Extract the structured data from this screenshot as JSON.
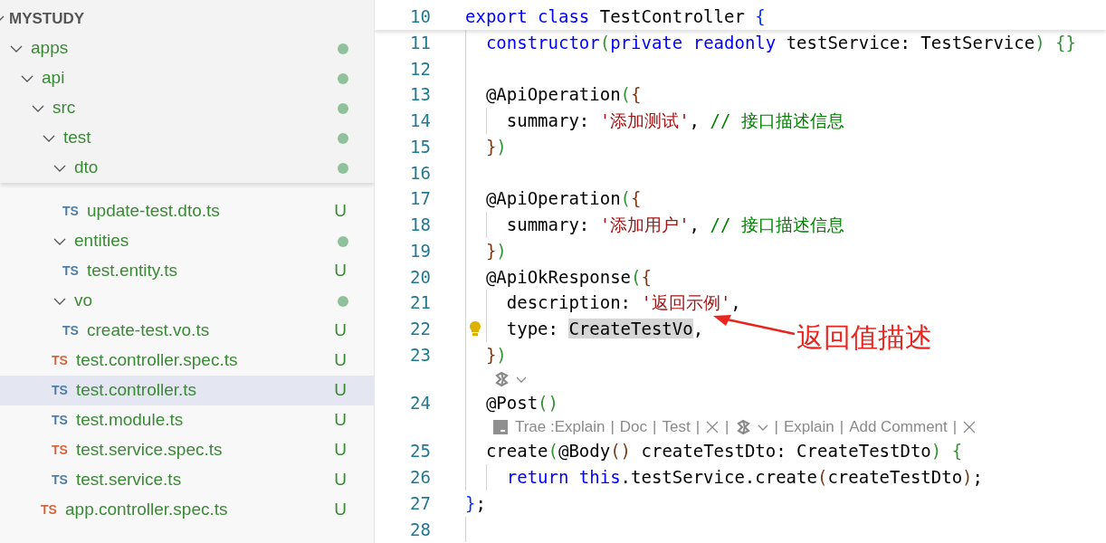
{
  "explorer": {
    "root": {
      "label": "MYSTUDY",
      "expanded": true
    },
    "tree": [
      {
        "kind": "folder",
        "label": "apps",
        "expanded": true,
        "modified": true,
        "children": [
          {
            "kind": "folder",
            "label": "api",
            "expanded": true,
            "modified": true,
            "children": [
              {
                "kind": "folder",
                "label": "src",
                "expanded": true,
                "modified": true,
                "children": [
                  {
                    "kind": "folder",
                    "label": "test",
                    "expanded": true,
                    "modified": true,
                    "children": [
                      {
                        "kind": "folder",
                        "label": "dto",
                        "expanded": true,
                        "modified": true,
                        "children": [
                          {
                            "kind": "file",
                            "label": "update-test.dto.ts",
                            "icon": "TS",
                            "color": "#4d7ea8",
                            "status": "U",
                            "selected": false
                          }
                        ]
                      },
                      {
                        "kind": "folder",
                        "label": "entities",
                        "expanded": true,
                        "modified": true,
                        "children": [
                          {
                            "kind": "file",
                            "label": "test.entity.ts",
                            "icon": "TS",
                            "color": "#4d7ea8",
                            "status": "U",
                            "selected": false
                          }
                        ]
                      },
                      {
                        "kind": "folder",
                        "label": "vo",
                        "expanded": true,
                        "modified": true,
                        "children": [
                          {
                            "kind": "file",
                            "label": "create-test.vo.ts",
                            "icon": "TS",
                            "color": "#4d7ea8",
                            "status": "U",
                            "selected": false
                          }
                        ]
                      },
                      {
                        "kind": "file",
                        "label": "test.controller.spec.ts",
                        "icon": "TS",
                        "color": "#d5673a",
                        "status": "U",
                        "selected": false
                      },
                      {
                        "kind": "file",
                        "label": "test.controller.ts",
                        "icon": "TS",
                        "color": "#4d7ea8",
                        "status": "U",
                        "selected": true
                      },
                      {
                        "kind": "file",
                        "label": "test.module.ts",
                        "icon": "TS",
                        "color": "#4d7ea8",
                        "status": "U",
                        "selected": false
                      },
                      {
                        "kind": "file",
                        "label": "test.service.spec.ts",
                        "icon": "TS",
                        "color": "#d5673a",
                        "status": "U",
                        "selected": false
                      },
                      {
                        "kind": "file",
                        "label": "test.service.ts",
                        "icon": "TS",
                        "color": "#4d7ea8",
                        "status": "U",
                        "selected": false
                      }
                    ]
                  },
                  {
                    "kind": "file",
                    "label": "app.controller.spec.ts",
                    "icon": "TS",
                    "color": "#d5673a",
                    "status": "U",
                    "selected": false
                  }
                ]
              }
            ]
          }
        ]
      }
    ]
  },
  "editor": {
    "sticky_lines": [
      {
        "kind": "code",
        "number": "10",
        "tokens": [
          {
            "kind": "keyword",
            "text": "export "
          },
          {
            "kind": "keyword",
            "text": "class "
          },
          {
            "kind": "plain",
            "text": "TestController "
          },
          {
            "kind": "bracket1",
            "text": "{"
          }
        ]
      }
    ],
    "lines": [
      {
        "kind": "code",
        "number": "11",
        "tokens": [
          {
            "kind": "keyword",
            "text": "  constructor"
          },
          {
            "kind": "bracket2",
            "text": "("
          },
          {
            "kind": "keyword",
            "text": "private "
          },
          {
            "kind": "keyword",
            "text": "readonly "
          },
          {
            "kind": "plain",
            "text": "testService: TestService"
          },
          {
            "kind": "bracket2",
            "text": ") {}"
          }
        ]
      },
      {
        "kind": "code",
        "number": "12"
      },
      {
        "kind": "code",
        "number": "13",
        "tokens": [
          {
            "kind": "plain",
            "text": "  @ApiOperation"
          },
          {
            "kind": "bracket2",
            "text": "("
          },
          {
            "kind": "bracket3",
            "text": "{"
          }
        ]
      },
      {
        "kind": "code",
        "number": "14",
        "tokens": [
          {
            "kind": "plain",
            "text": "    summary: "
          },
          {
            "kind": "string",
            "text": "'添加测试'"
          },
          {
            "kind": "plain",
            "text": ", "
          },
          {
            "kind": "comment",
            "text": "// 接口描述信息"
          }
        ]
      },
      {
        "kind": "code",
        "number": "15",
        "tokens": [
          {
            "kind": "bracket3",
            "text": "  }"
          },
          {
            "kind": "bracket2",
            "text": ")"
          }
        ]
      },
      {
        "kind": "code",
        "number": "16"
      },
      {
        "kind": "code",
        "number": "17",
        "tokens": [
          {
            "kind": "plain",
            "text": "  @ApiOperation"
          },
          {
            "kind": "bracket2",
            "text": "("
          },
          {
            "kind": "bracket3",
            "text": "{"
          }
        ]
      },
      {
        "kind": "code",
        "number": "18",
        "tokens": [
          {
            "kind": "plain",
            "text": "    summary: "
          },
          {
            "kind": "string",
            "text": "'添加用户'"
          },
          {
            "kind": "plain",
            "text": ", "
          },
          {
            "kind": "comment",
            "text": "// 接口描述信息"
          }
        ]
      },
      {
        "kind": "code",
        "number": "19",
        "tokens": [
          {
            "kind": "bracket3",
            "text": "  }"
          },
          {
            "kind": "bracket2",
            "text": ")"
          }
        ]
      },
      {
        "kind": "code",
        "number": "20",
        "tokens": [
          {
            "kind": "plain",
            "text": "  @ApiOkResponse"
          },
          {
            "kind": "bracket2",
            "text": "("
          },
          {
            "kind": "bracket3",
            "text": "{"
          }
        ]
      },
      {
        "kind": "code",
        "number": "21",
        "tokens": [
          {
            "kind": "plain",
            "text": "    description: "
          },
          {
            "kind": "string",
            "text": "'返回示例'"
          },
          {
            "kind": "plain",
            "text": ","
          }
        ]
      },
      {
        "kind": "code",
        "number": "22",
        "lightbulb": true,
        "tokens": [
          {
            "kind": "plain",
            "text": "    type: "
          },
          {
            "kind": "plain",
            "text": "CreateTestVo",
            "highlighted": true
          },
          {
            "kind": "plain",
            "text": ","
          }
        ]
      },
      {
        "kind": "code",
        "number": "23",
        "tokens": [
          {
            "kind": "bracket3",
            "text": "  }"
          },
          {
            "kind": "bracket2",
            "text": ")"
          }
        ]
      },
      {
        "kind": "lens",
        "items": [
          {
            "kind": "ai-menu"
          }
        ]
      },
      {
        "kind": "code",
        "number": "24",
        "tokens": [
          {
            "kind": "plain",
            "text": "  @Post"
          },
          {
            "kind": "bracket2",
            "text": "()"
          }
        ]
      },
      {
        "kind": "lens",
        "items": [
          {
            "kind": "terminal"
          },
          {
            "kind": "link",
            "text": "Trae :Explain"
          },
          {
            "kind": "sep",
            "text": "|"
          },
          {
            "kind": "link",
            "text": "Doc"
          },
          {
            "kind": "sep",
            "text": "|"
          },
          {
            "kind": "link",
            "text": "Test"
          },
          {
            "kind": "sep",
            "text": "|"
          },
          {
            "kind": "close"
          },
          {
            "kind": "sep",
            "text": "|"
          },
          {
            "kind": "ai-menu"
          },
          {
            "kind": "sep",
            "text": "|"
          },
          {
            "kind": "link",
            "text": "Explain"
          },
          {
            "kind": "sep",
            "text": "|"
          },
          {
            "kind": "link",
            "text": "Add Comment"
          },
          {
            "kind": "sep",
            "text": "|"
          },
          {
            "kind": "close"
          }
        ]
      },
      {
        "kind": "code",
        "number": "25",
        "tokens": [
          {
            "kind": "plain",
            "text": "  create"
          },
          {
            "kind": "bracket2",
            "text": "("
          },
          {
            "kind": "plain",
            "text": "@Body"
          },
          {
            "kind": "bracket3",
            "text": "()"
          },
          {
            "kind": "plain",
            "text": " createTestDto: CreateTestDto"
          },
          {
            "kind": "bracket2",
            "text": ") {"
          }
        ]
      },
      {
        "kind": "code",
        "number": "26",
        "tokens": [
          {
            "kind": "keyword",
            "text": "    return "
          },
          {
            "kind": "keyword",
            "text": "this"
          },
          {
            "kind": "plain",
            "text": ".testService.create"
          },
          {
            "kind": "bracket3",
            "text": "("
          },
          {
            "kind": "plain",
            "text": "createTestDto"
          },
          {
            "kind": "bracket3",
            "text": ")"
          },
          {
            "kind": "plain",
            "text": ";"
          }
        ]
      },
      {
        "kind": "code",
        "number": "27",
        "tokens": [
          {
            "kind": "bracket1",
            "text": "}"
          },
          {
            "kind": "plain",
            "text": ";"
          }
        ]
      },
      {
        "kind": "code",
        "number": "28"
      }
    ],
    "annotation": {
      "text": "返回值描述"
    }
  }
}
